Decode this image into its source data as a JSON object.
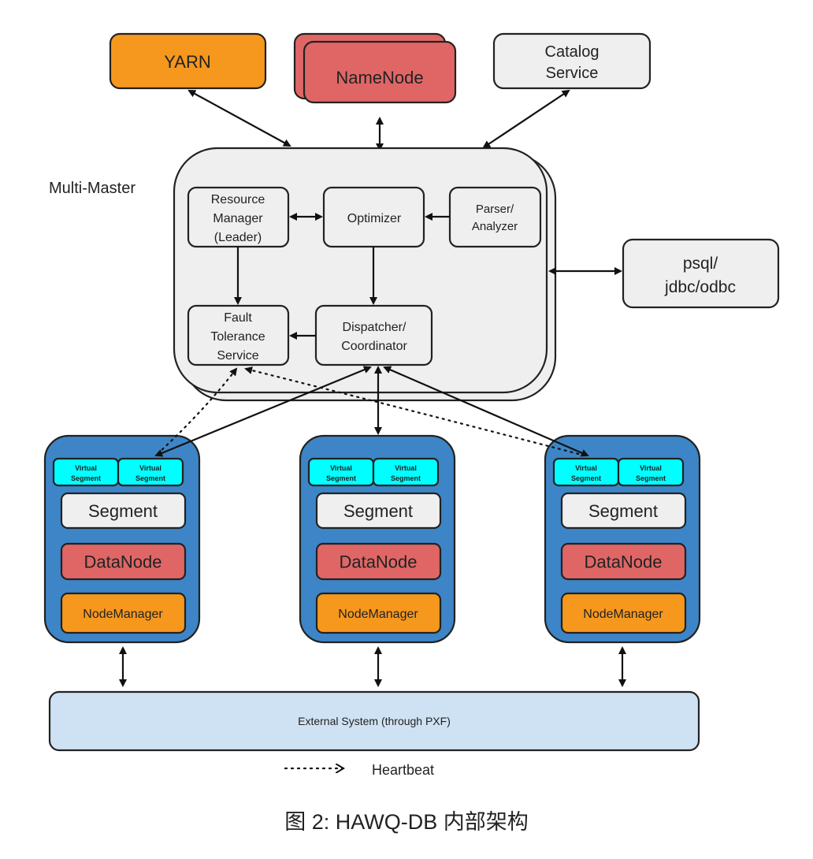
{
  "colors": {
    "yarn": "#f6981e",
    "namenode": "#e06666",
    "light": "#efefef",
    "segment_host": "#3d85c6",
    "virtual": "#00ffff",
    "external": "#cfe2f3"
  },
  "top": {
    "yarn": "YARN",
    "namenode": "NameNode",
    "catalog": [
      "Catalog",
      "Service"
    ]
  },
  "master": {
    "label": "Multi-Master",
    "resource_manager": [
      "Resource",
      "Manager",
      "(Leader)"
    ],
    "optimizer": "Optimizer",
    "parser": [
      "Parser/",
      "Analyzer"
    ],
    "fault": [
      "Fault",
      "Tolerance",
      "Service"
    ],
    "dispatcher": [
      "Dispatcher/",
      "Coordinator"
    ]
  },
  "client": [
    "psql/",
    "jdbc/odbc"
  ],
  "segment_host": {
    "virtual": [
      "Virtual",
      "Segment"
    ],
    "segment": "Segment",
    "datanode": "DataNode",
    "nodemanager": "NodeManager"
  },
  "external": "External System (through PXF)",
  "legend": {
    "heartbeat": "Heartbeat"
  },
  "caption": "图 2: HAWQ-DB  内部架构"
}
